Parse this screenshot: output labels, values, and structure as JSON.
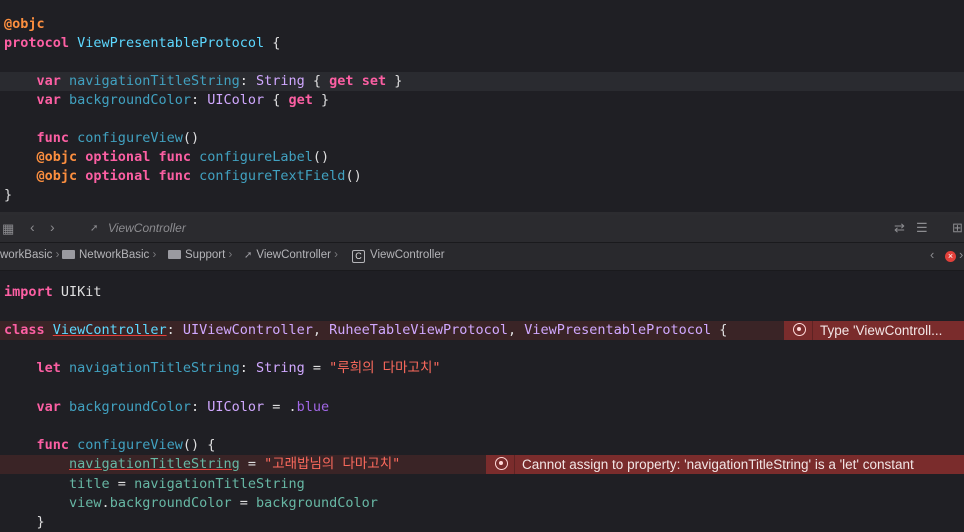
{
  "top_code": {
    "l1": "@objc",
    "l2_kw": "protocol",
    "l2_name": "ViewPresentableProtocol",
    "l2_rest": " {",
    "l3_var": "var",
    "l3_name": "navigationTitleString",
    "l3_colon": ": ",
    "l3_type": "String",
    "l3_brace": " { ",
    "l3_get": "get",
    "l3_set": "set",
    "l3_end": " }",
    "l4_var": "var",
    "l4_name": "backgroundColor",
    "l4_colon": ": ",
    "l4_type": "UIColor",
    "l4_brace": " { ",
    "l4_get": "get",
    "l4_end": " }",
    "l5_func": "func",
    "l5_name": "configureView",
    "l5_end": "()",
    "l6_objc": "@objc",
    "l6_opt": "optional",
    "l6_func": "func",
    "l6_name": "configureLabel",
    "l6_end": "()",
    "l7_objc": "@objc",
    "l7_opt": "optional",
    "l7_func": "func",
    "l7_name": "configureTextField",
    "l7_end": "()",
    "l8": "}"
  },
  "tabbar": {
    "file_tab": "ViewController"
  },
  "breadcrumb": {
    "items": [
      "workBasic",
      "NetworkBasic",
      "Support",
      "ViewController",
      "ViewController"
    ]
  },
  "bottom_code": {
    "import_kw": "import",
    "import_mod": "UIKit",
    "class_kw": "class",
    "class_name": "ViewController",
    "class_colon": ": ",
    "super1": "UIViewController",
    "comma1": ", ",
    "proto1": "RuheeTableViewProtocol",
    "comma2": ", ",
    "proto2": "ViewPresentableProtocol",
    "class_end": " {",
    "let_kw": "let",
    "let_name": "navigationTitleString",
    "let_colon": ": ",
    "let_type": "String",
    "let_eq": " = ",
    "let_val": "\"루희의 다마고치\"",
    "var_kw": "var",
    "var_name": "backgroundColor",
    "var_colon": ": ",
    "var_type": "UIColor",
    "var_eq": " = ",
    "var_dot": ".",
    "var_val": "blue",
    "func_kw": "func",
    "func_name": "configureView",
    "func_end": "() {",
    "a1_name": "navigationTitleString",
    "a1_eq": " = ",
    "a1_val": "\"고래밥님의 다마고치\"",
    "a2_name": "title",
    "a2_eq": " = ",
    "a2_val": "navigationTitleString",
    "a3_obj": "view",
    "a3_dot": ".",
    "a3_prop": "backgroundColor",
    "a3_eq": " = ",
    "a3_val": "backgroundColor",
    "close": "}"
  },
  "errors": {
    "class_error": "Type 'ViewControll...",
    "assign_error": "Cannot assign to property: 'navigationTitleString' is a 'let' constant"
  },
  "colors": {
    "background": "#1f1f24",
    "error_badge": "#7a2c2c",
    "keyword": "#fc5fa3"
  }
}
